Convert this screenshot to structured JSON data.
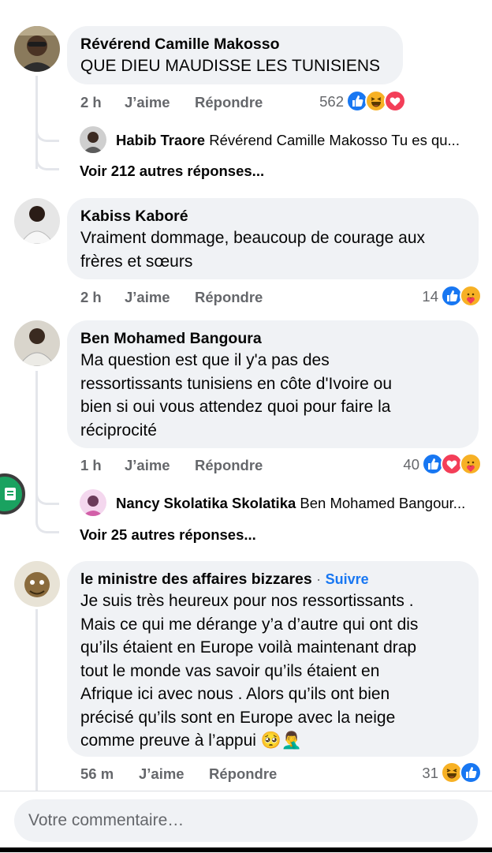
{
  "comments": [
    {
      "author": "Révérend  Camille Makosso",
      "text": "QUE DIEU MAUDISSE LES TUNISIENS",
      "time": "2 h",
      "like_label": "J’aime",
      "reply_label": "Répondre",
      "reaction_count": "562",
      "reactions": [
        "like-icon",
        "haha-icon",
        "love-icon"
      ],
      "reply_preview": {
        "author": "Habib Traore",
        "text": "Révérend  Camille Makosso Tu es qu..."
      },
      "more_replies": "Voir 212 autres réponses..."
    },
    {
      "author": "Kabiss Kaboré",
      "text_lines": [
        "Vraiment dommage, beaucoup de courage aux",
        "frères et sœurs"
      ],
      "time": "2 h",
      "like_label": "J’aime",
      "reply_label": "Répondre",
      "reaction_count": "14",
      "reactions": [
        "like-icon",
        "care-icon"
      ]
    },
    {
      "author": "Ben Mohamed Bangoura",
      "text_lines": [
        "Ma question est que il y'a pas des",
        "ressortissants tunisiens en côte d'Ivoire ou",
        "bien si oui vous attendez quoi pour faire la",
        "réciprocité"
      ],
      "time": "1 h",
      "like_label": "J’aime",
      "reply_label": "Répondre",
      "reaction_count": "40",
      "reactions": [
        "like-icon",
        "love-icon",
        "care-icon"
      ],
      "reply_preview": {
        "author": "Nancy Skolatika Skolatika",
        "text": "Ben Mohamed Bangour..."
      },
      "more_replies": "Voir 25 autres réponses..."
    },
    {
      "author": "le ministre des affaires bizzares",
      "separator": "·",
      "follow_label": "Suivre",
      "text_lines": [
        "Je suis très heureux pour nos ressortissants  .",
        "Mais ce qui me dérange y’a d’autre qui ont dis",
        "qu’ils étaient en Europe voilà maintenant drap",
        "tout le monde vas savoir qu’ils étaient en",
        "Afrique ici avec nous . Alors qu’ils ont bien",
        "précisé qu’ils sont en Europe avec la neige",
        "comme preuve à l’appui 🥺🤦‍♂️"
      ],
      "time": "56 m",
      "like_label": "J’aime",
      "reply_label": "Répondre",
      "reaction_count": "31",
      "reactions": [
        "haha-icon",
        "like-icon"
      ]
    }
  ],
  "composer": {
    "placeholder": "Votre commentaire…"
  },
  "colors": {
    "bubble": "#f0f2f5",
    "secondary_text": "#65676b",
    "link": "#1877f2",
    "like_blue": "#1877f2",
    "love_red": "#f33e58",
    "haha_yellow": "#f7b125"
  }
}
